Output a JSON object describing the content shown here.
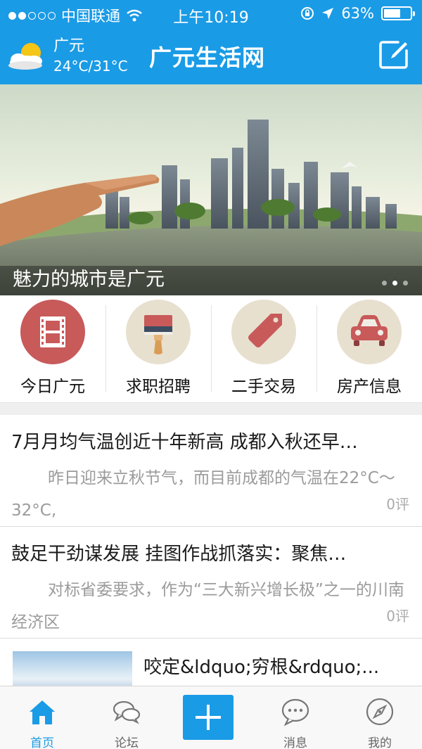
{
  "status_bar": {
    "carrier": "中国联通",
    "time": "上午10:19",
    "battery": "63%",
    "battery_level": 0.63
  },
  "header": {
    "weather": {
      "city": "广元",
      "temp": "24°C/31°C",
      "icon": "partly-cloudy-icon"
    },
    "title": "广元生活网",
    "edit_icon": "edit-icon"
  },
  "banner": {
    "caption": "魅力的城市是广元",
    "page_count": 3,
    "active_page": 1
  },
  "categories": [
    {
      "label": "今日广元",
      "icon": "film-icon",
      "color": "#c85a5a"
    },
    {
      "label": "求职招聘",
      "icon": "paint-brush-icon",
      "color": "#e8e0cf"
    },
    {
      "label": "二手交易",
      "icon": "tag-icon",
      "color": "#e8e0cf"
    },
    {
      "label": "房产信息",
      "icon": "car-icon",
      "color": "#e8e0cf"
    }
  ],
  "news": [
    {
      "title": "7月月均气温创近十年新高 成都入秋还早…",
      "summary": "昨日迎来立秋节气，而目前成都的气温在22°C～32°C,",
      "comments": "0评"
    },
    {
      "title": "鼓足干劲谋发展 挂图作战抓落实：聚焦…",
      "summary": "对标省委要求，作为“三大新兴增长极”之一的川南经济区",
      "comments": "0评"
    },
    {
      "title": "咬定&ldquo;穷根&rdquo;..."
    }
  ],
  "tabs": [
    {
      "label": "首页",
      "icon": "home-icon",
      "active": true
    },
    {
      "label": "论坛",
      "icon": "chat-bubbles-icon",
      "active": false
    },
    {
      "label": "",
      "icon": "plus-icon",
      "active": false
    },
    {
      "label": "消息",
      "icon": "message-icon",
      "active": false
    },
    {
      "label": "我的",
      "icon": "compass-icon",
      "active": false
    }
  ],
  "colors": {
    "brand": "#1a9be6",
    "tab_inactive": "#666666",
    "summary_text": "#9b9b9b"
  }
}
